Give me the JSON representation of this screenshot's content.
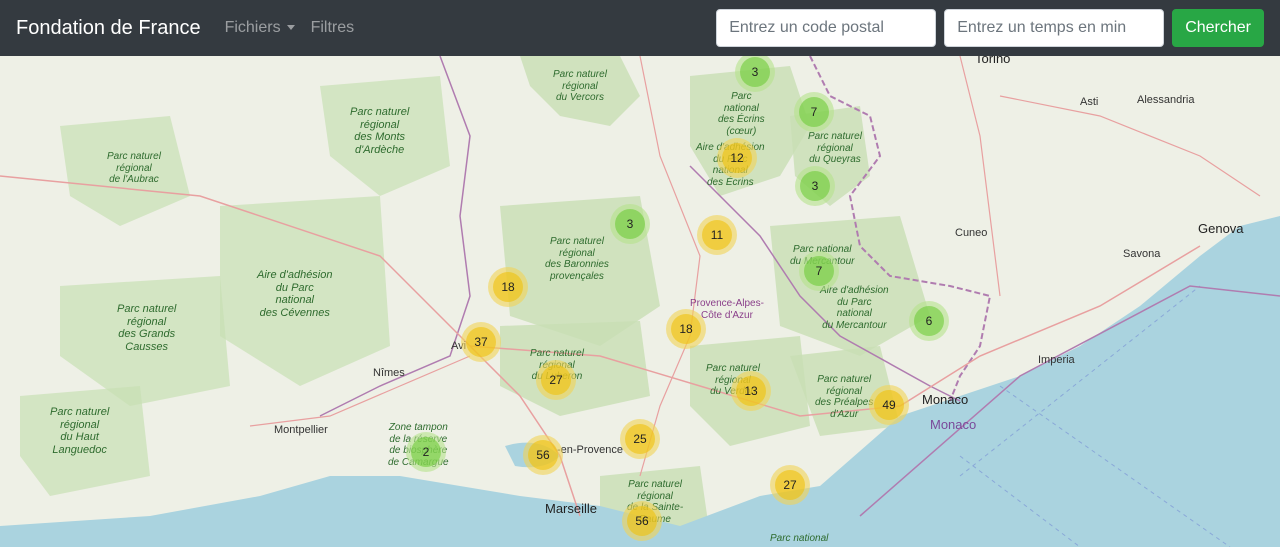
{
  "navbar": {
    "brand": "Fondation de France",
    "menu_files": "Fichiers",
    "menu_filters": "Filtres",
    "postal_placeholder": "Entrez un code postal",
    "time_placeholder": "Entrez un temps en min",
    "search_button": "Chercher",
    "colors": {
      "background": "#343a40",
      "button": "#28a745"
    }
  },
  "map": {
    "colors": {
      "sea": "#aad3df",
      "land": "#eef0e6",
      "park": "#c8dfb4",
      "border": "#b07cb0",
      "cluster_small": "#6ecc39",
      "cluster_medium": "#f0c20c"
    },
    "clusters": [
      {
        "count": "3",
        "size": "small"
      },
      {
        "count": "7",
        "size": "small"
      },
      {
        "count": "12",
        "size": "medium"
      },
      {
        "count": "3",
        "size": "small"
      },
      {
        "count": "3",
        "size": "small"
      },
      {
        "count": "11",
        "size": "medium"
      },
      {
        "count": "7",
        "size": "small"
      },
      {
        "count": "18",
        "size": "medium"
      },
      {
        "count": "18",
        "size": "medium"
      },
      {
        "count": "6",
        "size": "small"
      },
      {
        "count": "37",
        "size": "medium"
      },
      {
        "count": "27",
        "size": "medium"
      },
      {
        "count": "13",
        "size": "medium"
      },
      {
        "count": "49",
        "size": "medium"
      },
      {
        "count": "25",
        "size": "medium"
      },
      {
        "count": "2",
        "size": "small"
      },
      {
        "count": "56",
        "size": "medium"
      },
      {
        "count": "27",
        "size": "medium"
      },
      {
        "count": "56",
        "size": "medium"
      }
    ],
    "labels": {
      "torino": "Torino",
      "asti": "Asti",
      "alessandria": "Alessandria",
      "cuneo": "Cuneo",
      "genova": "Genova",
      "savona": "Savona",
      "imperia": "Imperia",
      "monaco_city": "Monaco",
      "monaco_country": "Monaco",
      "nimes": "Nîmes",
      "montpellier": "Montpellier",
      "avignon": "Avi",
      "aix": "-en-Provence",
      "marseille": "Marseille",
      "region": "Provence-Alpes-\nCôte d'Azur",
      "park_vercors": "Parc naturel\nrégional\ndu Vercors",
      "park_ecrins": "Parc\nnational\ndes Écrins\n(cœur)",
      "park_ecrins_adhesion": "Aire d'adhésion\ndu Parc\nnational\ndes Écrins",
      "park_queyras": "Parc naturel\nrégional\ndu Queyras",
      "park_ardeche": "Parc naturel\nrégional\ndes Monts\nd'Ardèche",
      "park_aubrac": "Parc naturel\nrégional\nde l'Aubrac",
      "park_baronnies": "Parc naturel\nrégional\ndes Baronnies\nprovençales",
      "park_cevennes": "Aire d'adhésion\ndu Parc\nnational\ndes Cévennes",
      "park_mercantour": "Parc national\ndu Mercantour",
      "park_mercantour_adhesion": "Aire d'adhésion\ndu Parc\nnational\ndu Mercantour",
      "park_grands_causses": "Parc naturel\nrégional\ndes Grands\nCausses",
      "park_luberon": "Parc naturel\nrégional\ndu Luberon",
      "park_verdon": "Parc naturel\nrégional\ndu Verdon",
      "park_prealpes": "Parc naturel\nrégional\ndes Préalpes\nd'Azur",
      "park_haut_languedoc": "Parc naturel\nrégional\ndu Haut\nLanguedoc",
      "park_camargue": "Zone tampon\nde la réserve\nde biosphère\nde Camargue",
      "park_sainte_baume": "Parc naturel\nrégional\nde la Sainte-\nBaume",
      "park_port_cros": "Parc national"
    }
  }
}
